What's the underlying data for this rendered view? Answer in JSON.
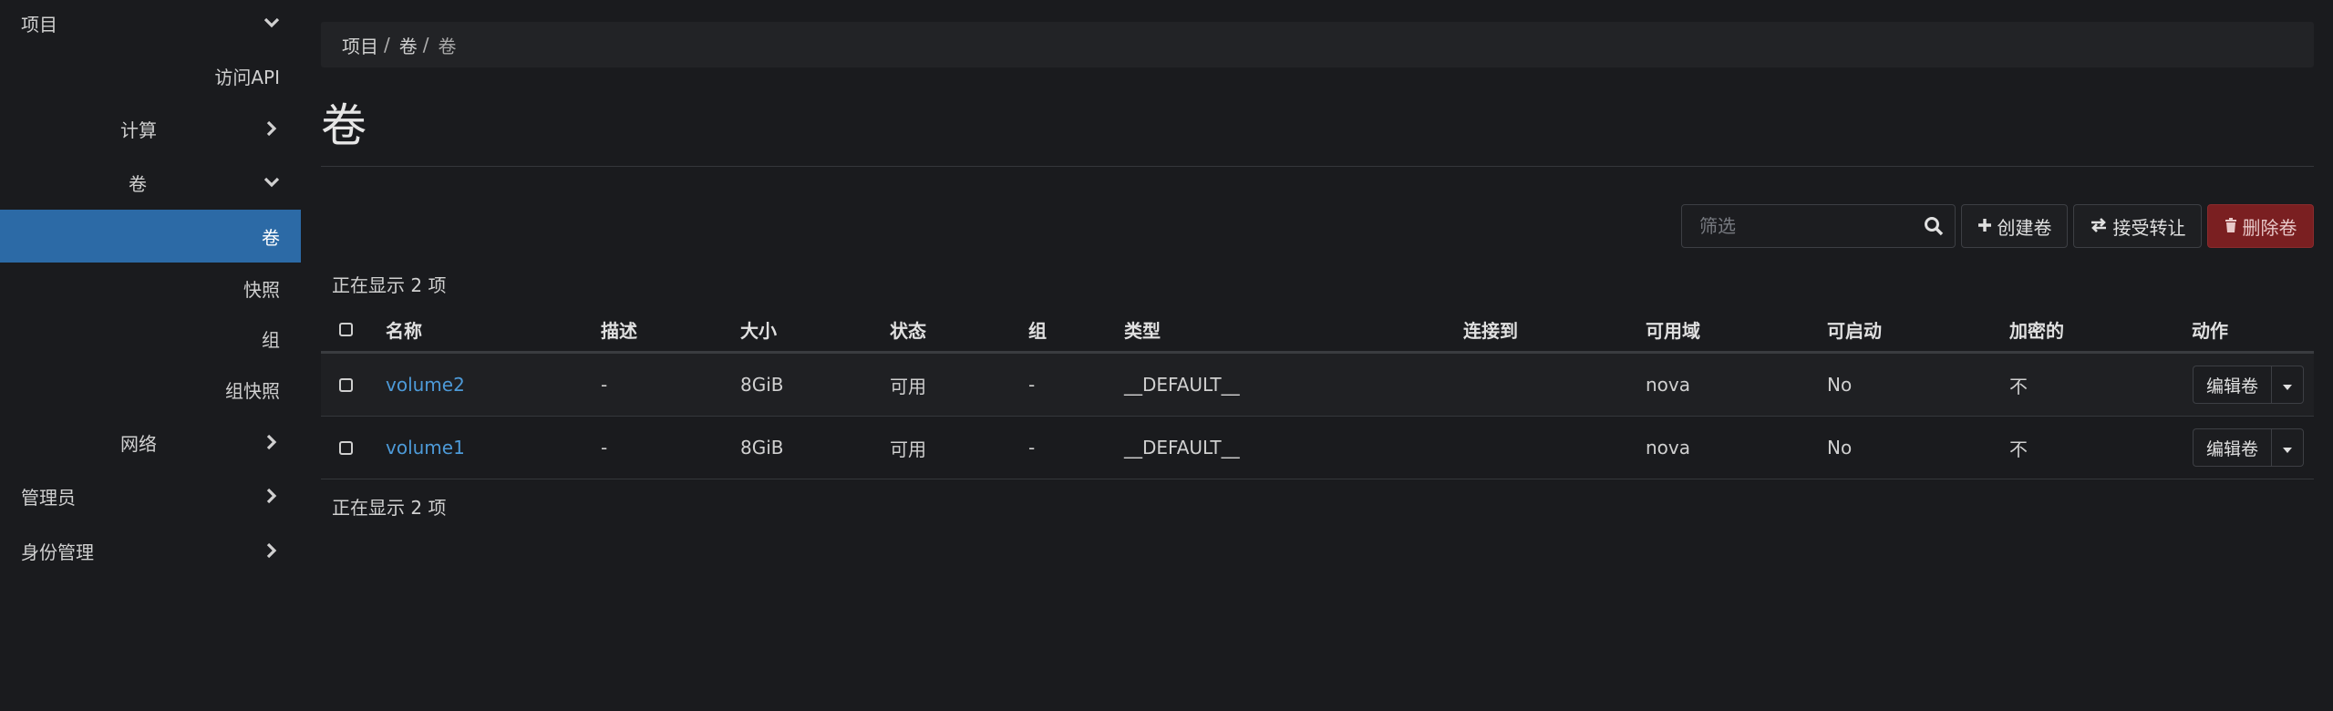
{
  "sidebar": {
    "project": "项目",
    "api_access": "访问API",
    "compute": "计算",
    "volumes_group": "卷",
    "volumes": "卷",
    "snapshots": "快照",
    "groups": "组",
    "group_snapshots": "组快照",
    "network": "网络",
    "admin": "管理员",
    "identity": "身份管理"
  },
  "breadcrumb": [
    "项目",
    "卷",
    "卷"
  ],
  "page_title": "卷",
  "toolbar": {
    "filter_placeholder": "筛选",
    "create": "创建卷",
    "accept_transfer": "接受转让",
    "delete": "删除卷"
  },
  "count_top": "正在显示 2 项",
  "count_bottom": "正在显示 2 项",
  "table": {
    "headers": {
      "name": "名称",
      "description": "描述",
      "size": "大小",
      "status": "状态",
      "group": "组",
      "type": "类型",
      "attached_to": "连接到",
      "az": "可用域",
      "bootable": "可启动",
      "encrypted": "加密的",
      "actions": "动作"
    },
    "rows": [
      {
        "name": "volume2",
        "description": "-",
        "size": "8GiB",
        "status": "可用",
        "group": "-",
        "type": "__DEFAULT__",
        "attached_to": "",
        "az": "nova",
        "bootable": "No",
        "encrypted": "不",
        "action": "编辑卷"
      },
      {
        "name": "volume1",
        "description": "-",
        "size": "8GiB",
        "status": "可用",
        "group": "-",
        "type": "__DEFAULT__",
        "attached_to": "",
        "az": "nova",
        "bootable": "No",
        "encrypted": "不",
        "action": "编辑卷"
      }
    ]
  },
  "colors": {
    "accent": "#2c6aa6",
    "link": "#4d9ad8",
    "danger": "#7a1f21",
    "background": "#1a1b1e"
  }
}
